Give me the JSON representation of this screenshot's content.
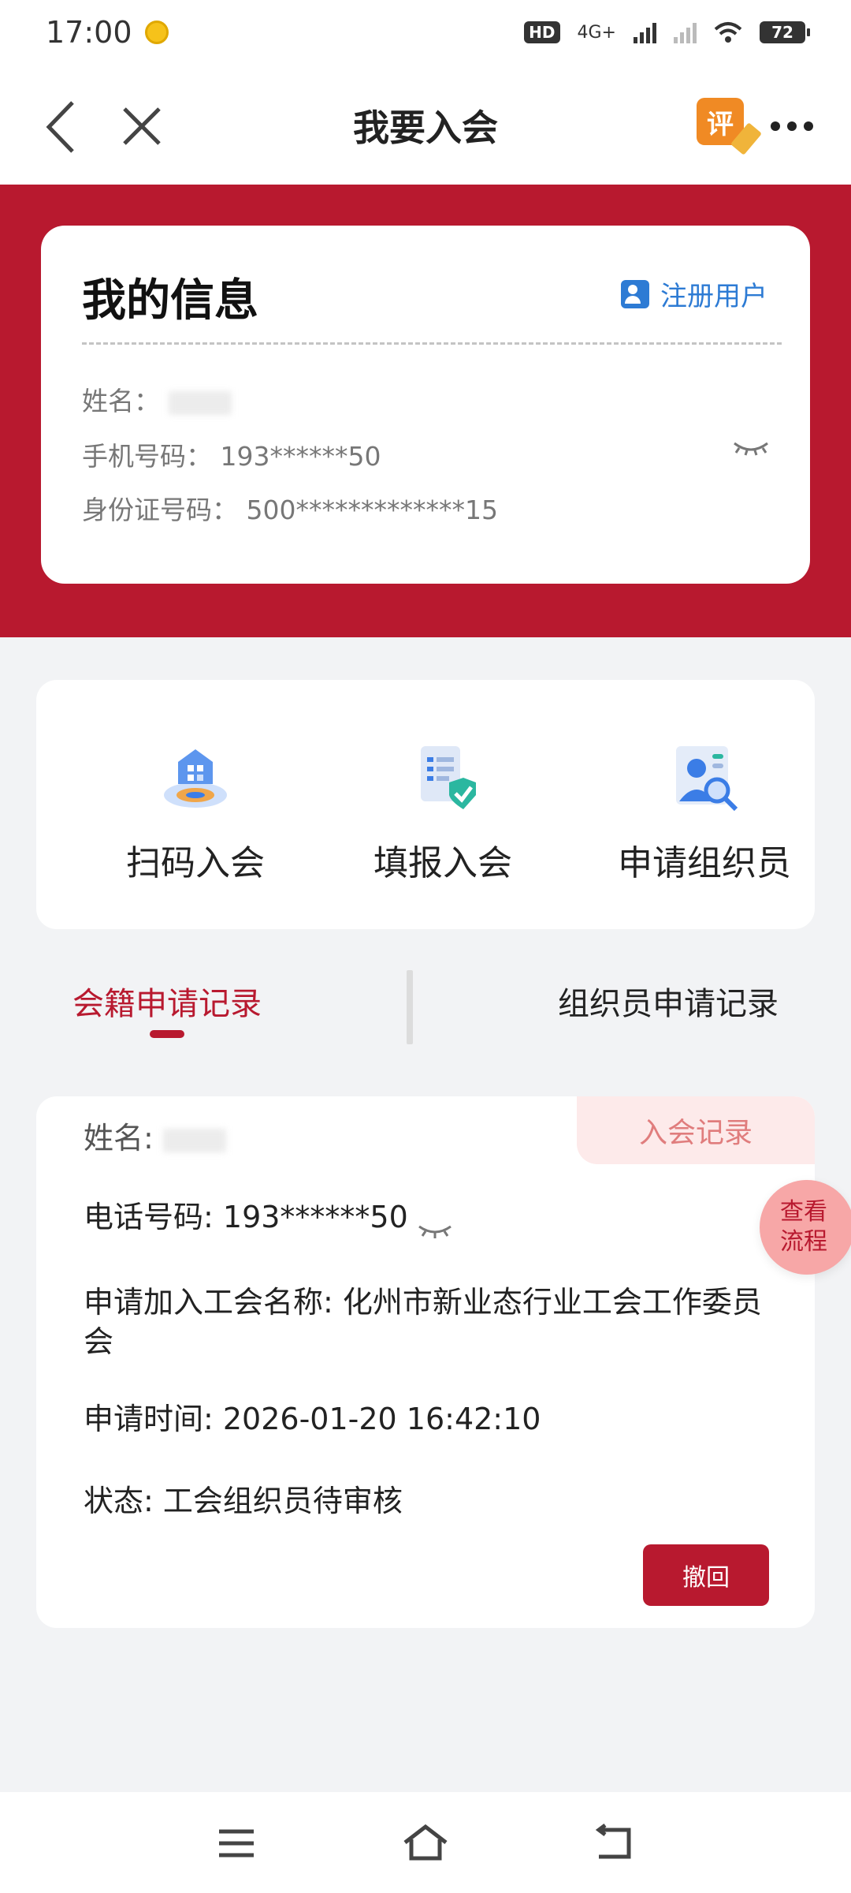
{
  "status_bar": {
    "time": "17:00",
    "hd_label": "HD",
    "network": "4G+",
    "battery": "72"
  },
  "title_bar": {
    "title": "我要入会",
    "review_label": "评"
  },
  "info_card": {
    "title": "我的信息",
    "register_label": "注册用户",
    "name_label": "姓名：",
    "phone_label": "手机号码：",
    "phone_value": "193******50",
    "id_label": "身份证号码：",
    "id_value": "500*************15"
  },
  "actions": {
    "scan_label": "扫码入会",
    "fill_label": "填报入会",
    "organizer_label": "申请组织员"
  },
  "tabs": {
    "membership": "会籍申请记录",
    "organizer": "组织员申请记录"
  },
  "record": {
    "badge": "入会记录",
    "name_label": "姓名:",
    "phone_label": "电话号码:",
    "phone_value": "193******50",
    "union_line": "申请加入工会名称: 化州市新业态行业工会工作委员会",
    "time_line": "申请时间: 2026-01-20 16:42:10",
    "status_line": "状态: 工会组织员待审核",
    "withdraw_label": "撤回"
  },
  "fab": {
    "line1": "查看",
    "line2": "流程"
  },
  "colors": {
    "brand_red": "#b8192f",
    "link_blue": "#2d7bd4",
    "background": "#f2f3f5"
  }
}
